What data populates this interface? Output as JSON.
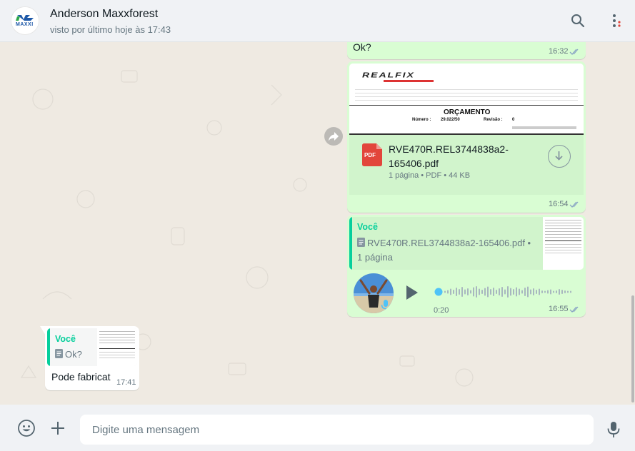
{
  "header": {
    "contact_name": "Anderson Maxxforest",
    "status": "visto por último hoje às 17:43",
    "avatar_text": "MAXXI"
  },
  "messages": [
    {
      "id": "m1",
      "direction": "out",
      "text": "Ok?",
      "time": "16:32",
      "status": "read"
    },
    {
      "id": "m2",
      "direction": "out",
      "type": "document",
      "preview": {
        "brand": "REALFIX",
        "doc_title": "ORÇAMENTO",
        "numero_label": "Número :",
        "numero_value": "29.022/50",
        "revisao_label": "Revisão :",
        "revisao_value": "0"
      },
      "file_name": "RVE470R.REL3744838a2-165406.pdf",
      "file_meta": "1 página • PDF • 44 KB",
      "file_badge": "PDF",
      "time": "16:54",
      "status": "read"
    },
    {
      "id": "m3",
      "direction": "out",
      "type": "audio",
      "quote_author": "Você",
      "quote_text": "RVE470R.REL3744838a2-165406.pdf • 1 página",
      "duration": "0:20",
      "time": "16:55",
      "status": "read"
    },
    {
      "id": "m4",
      "direction": "in",
      "quote_author": "Você",
      "quote_text": "Ok?",
      "text": "Pode fabricat",
      "time": "17:41"
    }
  ],
  "composer": {
    "placeholder": "Digite uma mensagem"
  },
  "colors": {
    "outgoing_bubble": "#d9fdd3",
    "incoming_bubble": "#ffffff",
    "accent": "#06cf9c",
    "read_ticks": "#53bdeb",
    "pdf_red": "#e2463b"
  }
}
